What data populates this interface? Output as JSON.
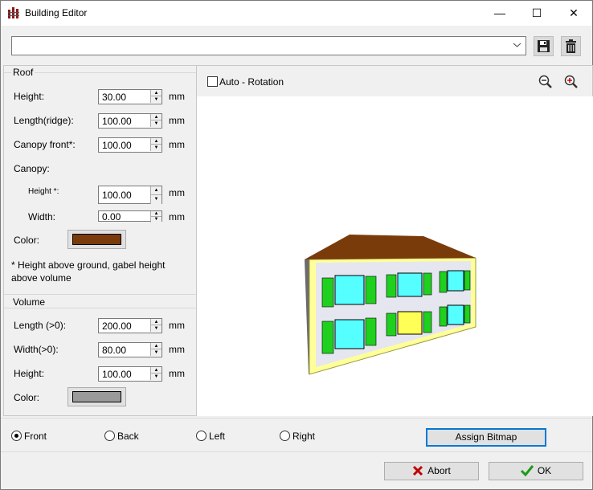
{
  "window": {
    "title": "Building Editor",
    "minimize_glyph": "—",
    "maximize_glyph": "☐",
    "close_glyph": "✕"
  },
  "toolbar": {
    "building_select_value": "",
    "save_icon": "floppy-disk-icon",
    "delete_icon": "trash-icon"
  },
  "roof": {
    "group_label": "Roof",
    "height_label": "Height:",
    "height_value": "30.00",
    "length_label": "Length(ridge):",
    "length_value": "100.00",
    "canopy_front_label": "Canopy front*:",
    "canopy_front_value": "100.00",
    "canopy_label": "Canopy:",
    "canopy_height_label": "Height *:",
    "canopy_height_value": "100.00",
    "canopy_width_label": "Width:",
    "canopy_width_value": "0.00",
    "color_label": "Color:",
    "color": "#7a3b0a",
    "note_line1": "* Height above ground, gabel height",
    "note_line2": "above volume",
    "unit": "mm"
  },
  "volume": {
    "group_label": "Volume",
    "length_label": "Length (>0):",
    "length_value": "200.00",
    "width_label": "Width(>0):",
    "width_value": "80.00",
    "height_label": "Height:",
    "height_value": "100.00",
    "color_label": "Color:",
    "color": "#9a9a9a",
    "unit": "mm"
  },
  "view": {
    "auto_rotation_label": "Auto - Rotation",
    "auto_rotation_checked": false,
    "zoom_out_icon": "zoom-out-icon",
    "zoom_in_icon": "zoom-in-icon"
  },
  "sides": {
    "front": "Front",
    "back": "Back",
    "left": "Left",
    "right": "Right",
    "selected": "Front"
  },
  "actions": {
    "assign_bitmap": "Assign Bitmap",
    "abort": "Abort",
    "ok": "OK"
  },
  "colors": {
    "accent": "#0078d7",
    "abort_icon": "#c00000",
    "ok_icon": "#1a9b1a"
  }
}
